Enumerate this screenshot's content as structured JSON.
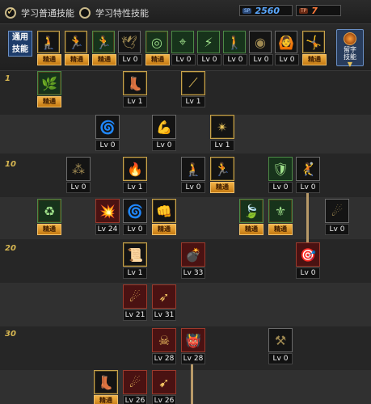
{
  "tabs": [
    {
      "label": "学习普通技能",
      "checked": true
    },
    {
      "label": "学习特性技能",
      "checked": false
    }
  ],
  "sp": [
    {
      "tag": "SP",
      "value": "2560",
      "color": "#5aa8ff"
    },
    {
      "tag": "TP",
      "value": "7",
      "color": "#ff7a3a"
    }
  ],
  "common_skills_label": "通用\n技能",
  "common_skills": [
    {
      "icon": "crouch-icon",
      "glyph": "🧎",
      "status": "精通"
    },
    {
      "icon": "sprint-icon",
      "glyph": "🏃",
      "status": "精通"
    },
    {
      "icon": "runner-icon",
      "glyph": "🏃",
      "status": "精通",
      "style": "green"
    },
    {
      "icon": "wings-icon",
      "glyph": "🕊",
      "status": "Lv 0"
    },
    {
      "icon": "target-icon",
      "glyph": "◎",
      "status": "精通",
      "style": "green"
    },
    {
      "icon": "crosshair-icon",
      "glyph": "⌖",
      "status": "Lv 0",
      "style": "green"
    },
    {
      "icon": "charge-icon",
      "glyph": "⚡",
      "status": "Lv 0",
      "style": "green"
    },
    {
      "icon": "figure-icon",
      "glyph": "🚶",
      "status": "Lv 0",
      "style": "green"
    },
    {
      "icon": "coin-icon",
      "glyph": "◉",
      "status": "Lv 0"
    },
    {
      "icon": "power-icon",
      "glyph": "🙆",
      "status": "Lv 0"
    },
    {
      "icon": "kick-icon",
      "glyph": "🤸",
      "status": "精通"
    }
  ],
  "right_button": {
    "label": "留字\n技能"
  },
  "level_markers": [
    "1",
    "10",
    "20",
    "30"
  ],
  "skills": [
    {
      "name": "vine-icon",
      "glyph": "🌿",
      "status": "精通",
      "style": "green",
      "learned": true
    },
    {
      "name": "boot-icon",
      "glyph": "👢",
      "status": "Lv 1",
      "learned": true
    },
    {
      "name": "slash-icon",
      "glyph": "⟋",
      "status": "Lv 1",
      "learned": true
    },
    {
      "name": "spin-kick-icon",
      "glyph": "🌀",
      "status": "Lv 0"
    },
    {
      "name": "flex-icon",
      "glyph": "💪",
      "status": "Lv 0"
    },
    {
      "name": "explosion-icon",
      "glyph": "✴",
      "status": "Lv 1",
      "learned": true
    },
    {
      "name": "scatter-icon",
      "glyph": "⁂",
      "status": "Lv 0"
    },
    {
      "name": "flame-strike-icon",
      "glyph": "🔥",
      "status": "Lv 1",
      "learned": true
    },
    {
      "name": "squat-icon",
      "glyph": "🧎",
      "status": "Lv 0"
    },
    {
      "name": "dash-icon",
      "glyph": "🏃",
      "status": "精通",
      "learned": true
    },
    {
      "name": "armor-icon",
      "glyph": "🛡",
      "status": "Lv 0",
      "style": "green"
    },
    {
      "name": "leap-icon",
      "glyph": "🤾",
      "status": "Lv 0"
    },
    {
      "name": "recycle-icon",
      "glyph": "♻",
      "status": "精通",
      "style": "green",
      "learned": true
    },
    {
      "name": "fire-burst-icon",
      "glyph": "💥",
      "status": "Lv 24",
      "style": "red"
    },
    {
      "name": "swirl-icon",
      "glyph": "🌀",
      "status": "Lv 0"
    },
    {
      "name": "fist-icon",
      "glyph": "👊",
      "status": "精通",
      "learned": true
    },
    {
      "name": "nature-icon",
      "glyph": "🍃",
      "status": "精通",
      "style": "green",
      "learned": true
    },
    {
      "name": "emblem-icon",
      "glyph": "⚜",
      "status": "精通",
      "style": "green",
      "learned": true
    },
    {
      "name": "fireball-icon",
      "glyph": "☄",
      "status": "Lv 0"
    },
    {
      "name": "scroll-icon",
      "glyph": "📜",
      "status": "Lv 1",
      "learned": true
    },
    {
      "name": "bomb-icon",
      "glyph": "💣",
      "status": "Lv 33",
      "style": "red"
    },
    {
      "name": "aim-icon",
      "glyph": "🎯",
      "status": "Lv 0",
      "style": "red"
    },
    {
      "name": "rain-arrows-icon",
      "glyph": "☄",
      "status": "Lv 21",
      "style": "red"
    },
    {
      "name": "arrows-icon",
      "glyph": "➶",
      "status": "Lv 31",
      "style": "red"
    },
    {
      "name": "skull-icon",
      "glyph": "☠",
      "status": "Lv 28",
      "style": "red"
    },
    {
      "name": "demon-icon",
      "glyph": "👹",
      "status": "Lv 28",
      "style": "red"
    },
    {
      "name": "cannon-icon",
      "glyph": "⚒",
      "status": "Lv 0"
    },
    {
      "name": "boots-gold-icon",
      "glyph": "👢",
      "status": "精通",
      "learned": true
    },
    {
      "name": "meteor-icon",
      "glyph": "☄",
      "status": "Lv 26",
      "style": "red"
    },
    {
      "name": "barrage-icon",
      "glyph": "➹",
      "status": "Lv 26",
      "style": "red"
    }
  ]
}
